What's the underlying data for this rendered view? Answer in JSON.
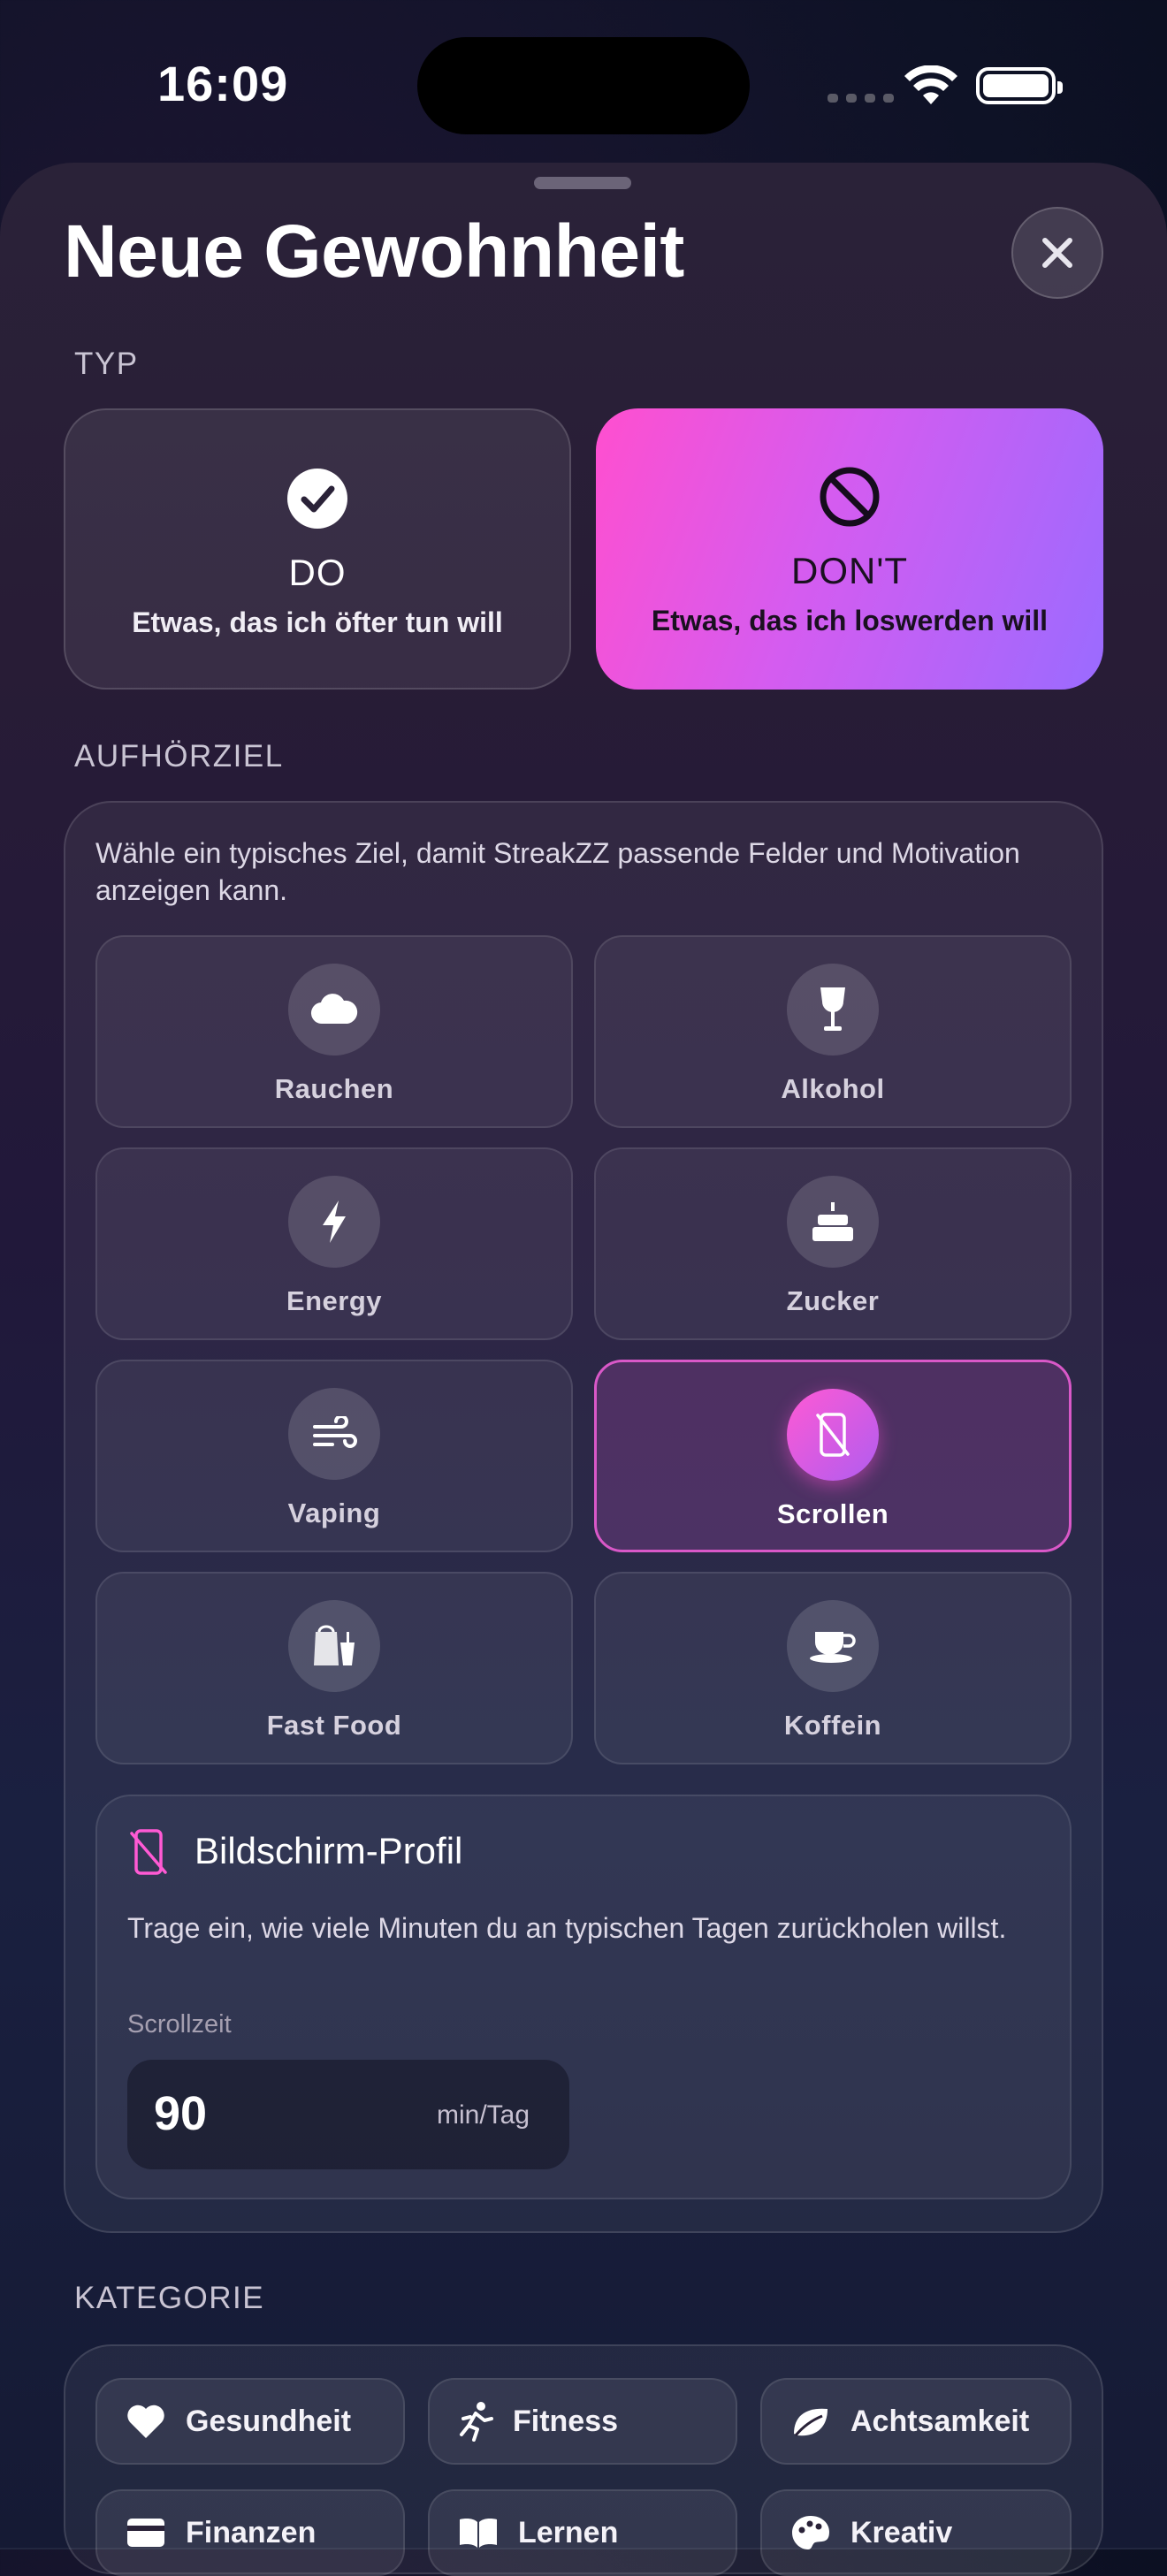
{
  "status_bar": {
    "time": "16:09"
  },
  "sheet": {
    "title": "Neue Gewohnheit"
  },
  "type_section": {
    "label": "TYP",
    "options": [
      {
        "title": "DO",
        "subtitle": "Etwas, das ich öfter tun will",
        "icon": "checkmark-circle-icon",
        "selected": false
      },
      {
        "title": "DON'T",
        "subtitle": "Etwas, das ich loswerden will",
        "icon": "prohibited-icon",
        "selected": true
      }
    ]
  },
  "goal_section": {
    "label": "AUFHÖRZIEL",
    "description": "Wähle ein typisches Ziel, damit StreakZZ passende Felder und Motivation anzeigen kann.",
    "goals": [
      {
        "label": "Rauchen",
        "icon": "smoke-icon"
      },
      {
        "label": "Alkohol",
        "icon": "wine-glass-icon"
      },
      {
        "label": "Energy",
        "icon": "bolt-icon"
      },
      {
        "label": "Zucker",
        "icon": "cake-icon"
      },
      {
        "label": "Vaping",
        "icon": "wind-icon"
      },
      {
        "label": "Scrollen",
        "icon": "phone-slash-icon",
        "selected": true
      },
      {
        "label": "Fast Food",
        "icon": "takeout-icon"
      },
      {
        "label": "Koffein",
        "icon": "coffee-cup-icon"
      }
    ],
    "profile": {
      "title": "Bildschirm-Profil",
      "description": "Trage ein, wie viele Minuten du an typischen Tagen zurückholen willst.",
      "field_label": "Scrollzeit",
      "value": "90",
      "unit": "min/Tag"
    }
  },
  "category_section": {
    "label": "KATEGORIE",
    "chips": [
      {
        "label": "Gesundheit",
        "icon": "heart-icon"
      },
      {
        "label": "Fitness",
        "icon": "runner-icon"
      },
      {
        "label": "Achtsamkeit",
        "icon": "leaf-icon"
      },
      {
        "label": "Finanzen",
        "icon": "card-icon"
      },
      {
        "label": "Lernen",
        "icon": "book-icon"
      },
      {
        "label": "Kreativ",
        "icon": "palette-icon"
      }
    ]
  },
  "colors": {
    "accent_pink": "#ff4fcf",
    "accent_purple": "#9a6bff"
  }
}
